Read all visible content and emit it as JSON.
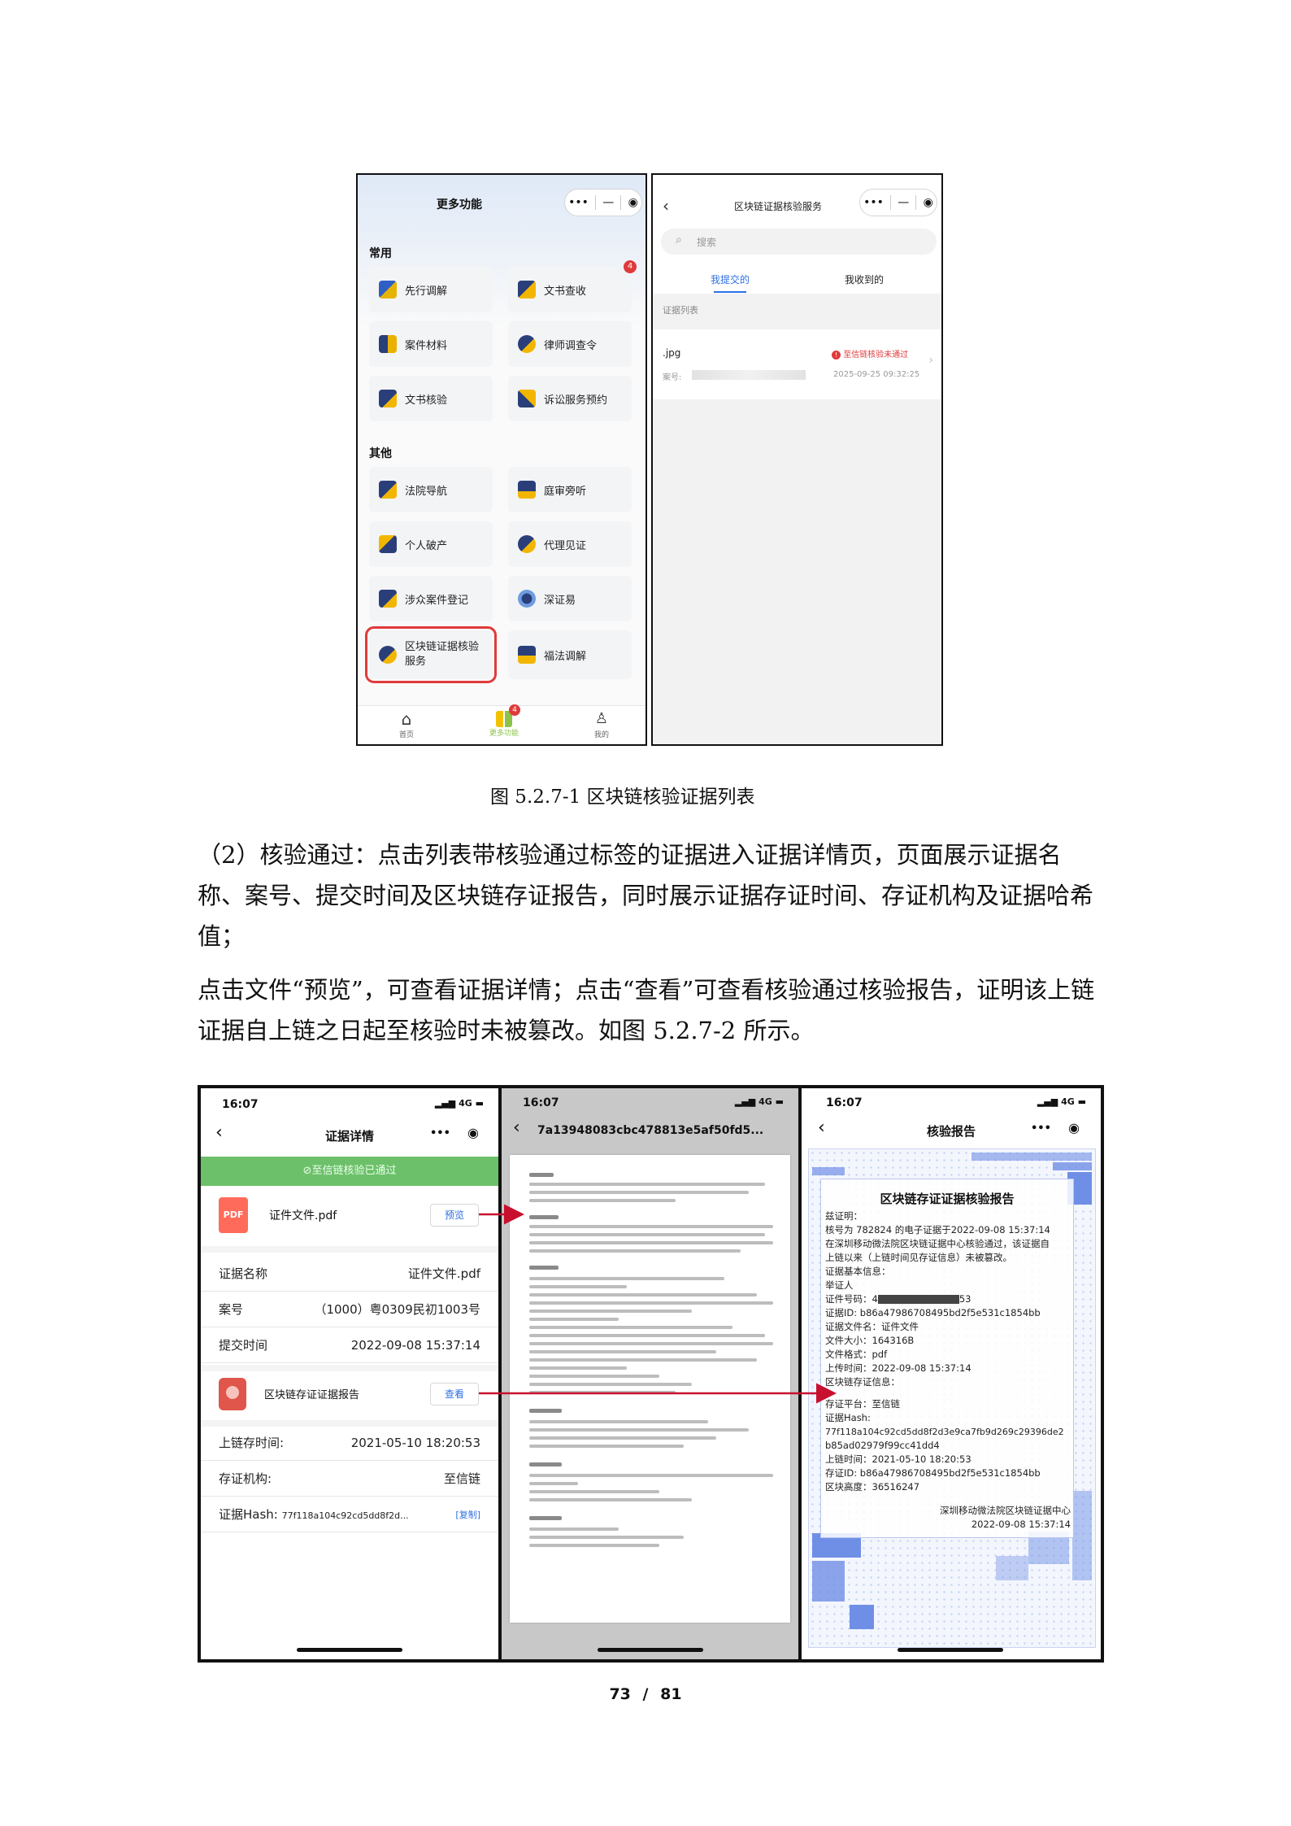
{
  "figure1": {
    "left_phone": {
      "title": "更多功能",
      "section_common": "常用",
      "section_other": "其他",
      "common_items": [
        {
          "label": "先行调解",
          "icon": "people-icon"
        },
        {
          "label": "文书查收",
          "icon": "document-receive-icon",
          "badge": "4"
        },
        {
          "label": "案件材料",
          "icon": "case-files-icon"
        },
        {
          "label": "律师调查令",
          "icon": "lawyer-icon"
        },
        {
          "label": "文书核验",
          "icon": "document-verify-icon"
        },
        {
          "label": "诉讼服务预约",
          "icon": "appointment-icon"
        }
      ],
      "other_items": [
        {
          "label": "法院导航",
          "icon": "court-navigation-icon"
        },
        {
          "label": "庭审旁听",
          "icon": "court-hearing-icon"
        },
        {
          "label": "个人破产",
          "icon": "bankruptcy-icon"
        },
        {
          "label": "代理见证",
          "icon": "agent-witness-icon"
        },
        {
          "label": "涉众案件登记",
          "icon": "registration-icon"
        },
        {
          "label": "深证易",
          "icon": "shenzhengyi-icon"
        },
        {
          "label": "区块链证据核验服务",
          "icon": "blockchain-verify-icon",
          "highlighted": true
        },
        {
          "label": "福法调解",
          "icon": "scale-icon"
        }
      ],
      "tabbar": [
        {
          "label": "首页",
          "icon": "home-icon"
        },
        {
          "label": "更多功能",
          "icon": "grid-icon",
          "badge": "4"
        },
        {
          "label": "我的",
          "icon": "user-icon"
        }
      ]
    },
    "right_phone": {
      "title": "区块链证据核验服务",
      "search_placeholder": "搜索",
      "tabs": [
        "我提交的",
        "我收到的"
      ],
      "list_header": "证据列表",
      "item": {
        "filename": ".jpg",
        "case_label": "案号:",
        "status": "至信链核验未通过",
        "datetime": "2025-09-25 09:32:25"
      }
    },
    "caption": "图 5.2.7-1 区块链核验证据列表"
  },
  "paragraphs": [
    "（2）核验通过：点击列表带核验通过标签的证据进入证据详情页，页面展示证据名称、案号、提交时间及区块链存证报告，同时展示证据存证时间、存证机构及证据哈希值；",
    "点击文件“预览”，可查看证据详情；点击“查看”可查看核验通过核验报告，证明该上链证据自上链之日起至核验时未被篡改。如图 5.2.7-2 所示。"
  ],
  "figure2": {
    "phone_a": {
      "time": "16:07",
      "signal": "4G",
      "title": "证据详情",
      "banner": "至信链核验已通过",
      "file_icon_text": "PDF",
      "file_name": "证件文件.pdf",
      "preview_button": "预览",
      "fields": [
        {
          "label": "证据名称",
          "value": "证件文件.pdf"
        },
        {
          "label": "案号",
          "value": "（1000）粤0309民初1003号"
        },
        {
          "label": "提交时间",
          "value": "2022-09-08 15:37:14"
        }
      ],
      "report_name": "区块链存证证据报告",
      "view_button": "查看",
      "chain_fields": [
        {
          "label": "上链存时间:",
          "value": "2021-05-10 18:20:53"
        },
        {
          "label": "存证机构:",
          "value": "至信链"
        }
      ],
      "hash_label": "证据Hash:",
      "hash_value": "77f118a104c92cd5dd8f2d...",
      "copy_button": "[复制]"
    },
    "phone_b": {
      "time": "16:07",
      "signal": "4G",
      "title": "7a13948083cbc478813e5af50fd5..."
    },
    "phone_c": {
      "time": "16:07",
      "signal": "4G",
      "title": "核验报告",
      "report_title": "区块链存证证据核验报告",
      "lines": [
        "兹证明：",
        "    核号为 782824 的电子证据于2022-09-08 15:37:14",
        "在深圳移动微法院区块链证据中心核验通过，该证据自",
        "上链以来（上链时间见存证信息）未被篡改。",
        "证据基本信息：",
        "    举证人",
        "    证件号码：4",
        "    证据ID: b86a47986708495bd2f5e531c1854bb",
        "    证据文件名：证件文件",
        "    文件大小：164316B",
        "    文件格式：pdf",
        "    上传时间：2022-09-08 15:37:14",
        "区块链存证信息：",
        "",
        "    存证平台：至信链",
        "    证据Hash:",
        "77f118a104c92cd5dd8f2d3e9ca7fb9d269c29396de2",
        "b85ad02979f99cc41dd4",
        "    上链时间：2021-05-10 18:20:53",
        "    存证ID: b86a47986708495bd2f5e531c1854bb",
        "    区块高度：36516247"
      ],
      "id_suffix": "53",
      "issuer": "深圳移动微法院区块链证据中心",
      "issue_time": "2022-09-08 15:37:14"
    }
  },
  "footer": {
    "page_current": "73",
    "page_sep": "/",
    "page_total": "81"
  },
  "colors": {
    "brand_blue": "#2f6fe4",
    "verified_green": "#6cc06a",
    "alert_red": "#e03a3a",
    "arrow_red": "#c8102e",
    "report_pixel_blue": "#6f8fe6"
  }
}
